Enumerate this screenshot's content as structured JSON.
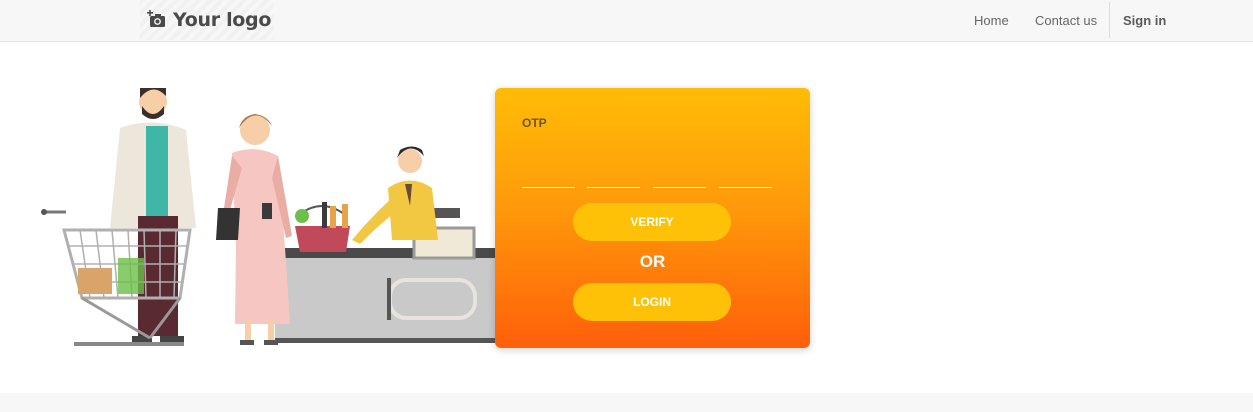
{
  "header": {
    "logo_text": "Your logo",
    "logo_icon": "camera-add-icon",
    "nav": {
      "home": "Home",
      "contact": "Contact us",
      "signin": "Sign in"
    }
  },
  "otp_card": {
    "label": "OTP",
    "otp_digit_count": 4,
    "verify_label": "VERIFY",
    "or_text": "OR",
    "login_label": "LOGIN"
  },
  "colors": {
    "card_gradient_top": "#ffbc06",
    "card_gradient_bottom": "#ff5f0a",
    "button": "#ffc107",
    "header_bg": "#f7f7f7"
  }
}
